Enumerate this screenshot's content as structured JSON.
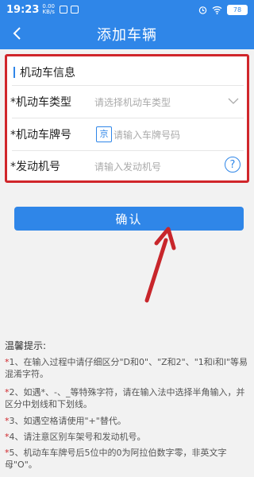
{
  "status": {
    "time": "19:23",
    "net_top": "0.00",
    "net_bottom": "KB/s",
    "battery": "78"
  },
  "nav": {
    "title": "添加车辆"
  },
  "form": {
    "section_title": "机动车信息",
    "vehicle_type": {
      "label": "*机动车类型",
      "placeholder": "请选择机动车类型"
    },
    "plate": {
      "label": "*机动车牌号",
      "prefix": "京",
      "placeholder": "请输入车牌号码"
    },
    "engine": {
      "label": "*发动机号",
      "placeholder": "请输入发动机号",
      "help": "?"
    }
  },
  "confirm_label": "确认",
  "tips": {
    "title": "温馨提示:",
    "items": [
      {
        "star": "*",
        "text": "1、在输入过程中请仔细区分\"D和0\"、\"Z和2\"、\"1和i和l\"等易混淆字符。"
      },
      {
        "star": "*",
        "text": "2、如遇*、-、_等特殊字符，请在输入法中选择半角输入，并区分中划线和下划线。"
      },
      {
        "star": "*",
        "text": "3、如遇空格请使用\"+\"替代。"
      },
      {
        "star": "*",
        "text": "4、请注意区别车架号和发动机号。"
      },
      {
        "star": "*",
        "text": "5、机动车车牌号后5位中的0为阿拉伯数字零，非英文字母\"O\"。"
      }
    ]
  },
  "colors": {
    "primary": "#2f86e8",
    "highlight": "#d0262b"
  }
}
